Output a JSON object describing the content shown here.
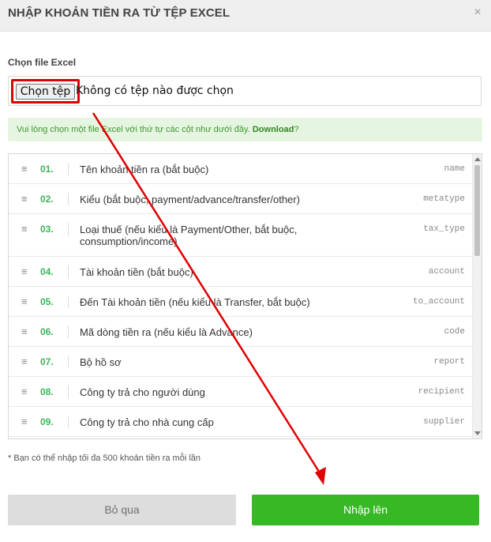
{
  "modal": {
    "title": "NHẬP KHOẢN TIỀN RA TỪ TỆP EXCEL",
    "close_symbol": "×"
  },
  "file_field": {
    "label": "Chọn file Excel",
    "button_label": "Chọn tệp",
    "status": "Không có tệp nào được chọn"
  },
  "notice": {
    "text": "Vui lòng chọn một file Excel với thứ tự các cột như dưới đây. ",
    "link": "Download",
    "suffix": "?"
  },
  "columns": [
    {
      "num": "01.",
      "label": "Tên khoản tiền ra (bắt buộc)",
      "code": "name"
    },
    {
      "num": "02.",
      "label": "Kiểu (bắt buộc, payment/advance/transfer/other)",
      "code": "metatype"
    },
    {
      "num": "03.",
      "label": "Loại thuế (nếu kiểu là Payment/Other, bắt buộc, consumption/income)",
      "code": "tax_type"
    },
    {
      "num": "04.",
      "label": "Tài khoản tiền (bắt buộc)",
      "code": "account"
    },
    {
      "num": "05.",
      "label": "Đến Tài khoản tiền (nếu kiểu là Transfer, bắt buộc)",
      "code": "to_account"
    },
    {
      "num": "06.",
      "label": "Mã dòng tiền ra (nếu kiểu là Advance)",
      "code": "code"
    },
    {
      "num": "07.",
      "label": "Bộ hồ sơ",
      "code": "report"
    },
    {
      "num": "08.",
      "label": "Công ty trả cho người dùng",
      "code": "recipient"
    },
    {
      "num": "09.",
      "label": "Công ty trả cho nhà cung cấp",
      "code": "supplier"
    }
  ],
  "footnote": "* Bạn có thể nhập tối đa 500 khoản tiền ra mỗi lần",
  "actions": {
    "skip": "Bỏ qua",
    "submit": "Nhập lên"
  },
  "icons": {
    "drag": "drag-handle-icon",
    "close": "close-icon"
  },
  "colors": {
    "accent_green": "#37b825",
    "annotation_red": "#e00000"
  }
}
